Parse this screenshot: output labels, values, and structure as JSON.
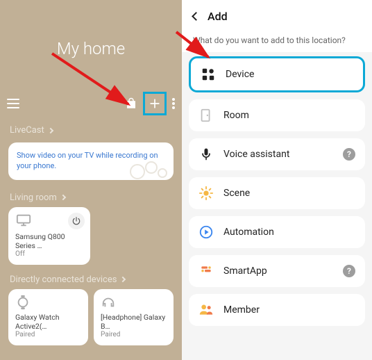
{
  "colors": {
    "left_bg": "#c1b096",
    "highlight": "#0ba9d6",
    "link_blue": "#3a78d0",
    "arrow": "#e11b1b"
  },
  "left": {
    "title": "My home",
    "sections": {
      "livecast": {
        "header": "LiveCast",
        "card_text": "Show video on your TV while recording on your phone."
      },
      "living_room": {
        "header": "Living room",
        "device_name": "Samsung Q800 Series …",
        "device_status": "Off"
      },
      "direct": {
        "header": "Directly connected devices",
        "items": [
          {
            "name": "Galaxy Watch Active2(…",
            "status": "Paired"
          },
          {
            "name": "[Headphone] Galaxy B…",
            "status": "Paired"
          }
        ]
      }
    }
  },
  "right": {
    "header_title": "Add",
    "prompt": "What do you want to add to this location?",
    "items": [
      {
        "label": "Device",
        "icon": "device-icon",
        "highlighted": true,
        "help": false
      },
      {
        "label": "Room",
        "icon": "room-icon",
        "highlighted": false,
        "help": false
      },
      {
        "label": "Voice assistant",
        "icon": "mic-icon",
        "highlighted": false,
        "help": true
      },
      {
        "label": "Scene",
        "icon": "scene-icon",
        "highlighted": false,
        "help": false
      },
      {
        "label": "Automation",
        "icon": "automation-icon",
        "highlighted": false,
        "help": false
      },
      {
        "label": "SmartApp",
        "icon": "smartapp-icon",
        "highlighted": false,
        "help": true
      },
      {
        "label": "Member",
        "icon": "member-icon",
        "highlighted": false,
        "help": false
      }
    ],
    "help_symbol": "?"
  }
}
